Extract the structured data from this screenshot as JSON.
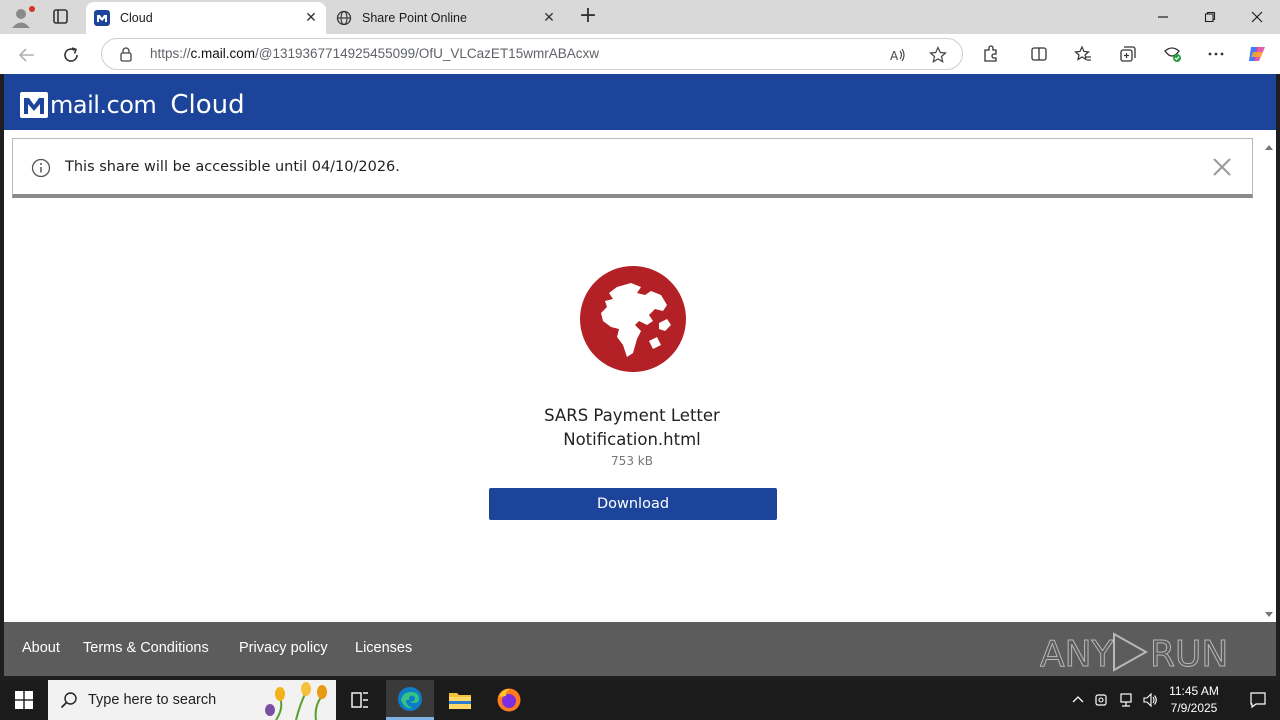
{
  "browser": {
    "tabs": [
      {
        "title": "Cloud",
        "favicon": "mail-com-icon",
        "active": true
      },
      {
        "title": "Share Point Online",
        "favicon": "globe-icon",
        "active": false
      }
    ],
    "url_prefix": "https://",
    "url_host": "c.mail.com",
    "url_path": "/@1319367714925455099/OfU_VLCazET15wmrABAcxw"
  },
  "page": {
    "brand": "mail.com",
    "product": "Cloud",
    "notice": "This share will be accessible until 04/10/2026.",
    "file": {
      "name_line1": "SARS Payment Letter",
      "name_line2": "Notification.html",
      "size": "753 kB"
    },
    "download_label": "Download",
    "footer_links": [
      "About",
      "Terms & Conditions",
      "Privacy policy",
      "Licenses"
    ],
    "accent_color": "#1c449b",
    "globe_color": "#b32025",
    "watermark": "ANY RUN"
  },
  "taskbar": {
    "search_placeholder": "Type here to search",
    "time": "11:45 AM",
    "date": "7/9/2025"
  }
}
